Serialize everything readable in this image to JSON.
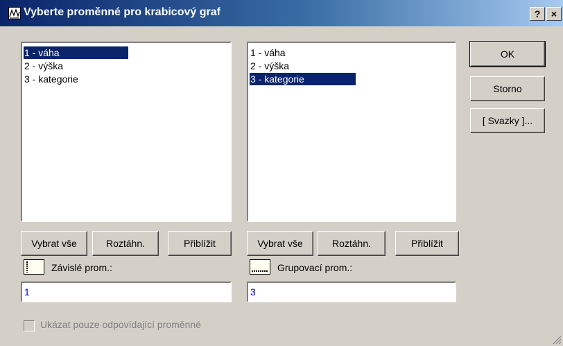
{
  "window": {
    "title": "Vyberte proměnné pro krabicový graf",
    "help_label": "?",
    "close_label": "×"
  },
  "left_list": {
    "items": [
      "1 - váha",
      "2 - výška",
      "3 - kategorie"
    ],
    "selected_index": 0
  },
  "right_list": {
    "items": [
      "1 - váha",
      "2 - výška",
      "3 - kategorie"
    ],
    "selected_index": 2
  },
  "left_buttons": {
    "select_all": "Vybrat vše",
    "spread": "Roztáhn.",
    "zoom": "Přiblížit"
  },
  "right_buttons": {
    "select_all": "Vybrat vše",
    "spread": "Roztáhn.",
    "zoom": "Přiblížit"
  },
  "dependent": {
    "label": "Závislé prom.:",
    "value": "1"
  },
  "grouping": {
    "label": "Grupovací prom.:",
    "value": "3"
  },
  "side_buttons": {
    "ok": "OK",
    "cancel": "Storno",
    "bundles": "[ Svazky ]..."
  },
  "option": {
    "label": "Ukázat pouze odpovídající proměnné",
    "checked": false,
    "enabled": false
  }
}
